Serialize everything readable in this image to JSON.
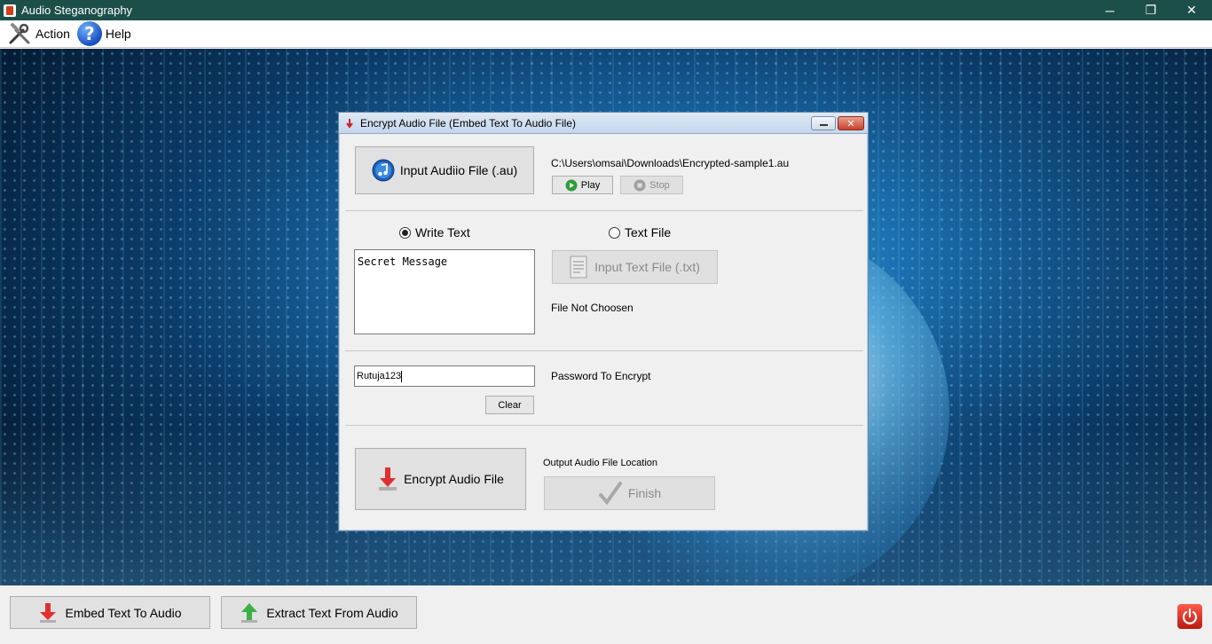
{
  "window": {
    "title": "Audio Steganography",
    "controls": {
      "minimize": "─",
      "maximize": "❐",
      "close": "✕"
    }
  },
  "menu": {
    "action_label": "Action",
    "help_label": "Help"
  },
  "dialog": {
    "title": "Encrypt Audio File (Embed Text To Audio File)",
    "input_audio_button": "Input Audiio File (.au)",
    "audio_path": "C:\\Users\\omsai\\Downloads\\Encrypted-sample1.au",
    "play_button": "Play",
    "stop_button": "Stop",
    "write_text_radio": "Write Text",
    "text_file_radio": "Text File",
    "write_text_selected": true,
    "message_text": "Secret Message",
    "input_text_file_button": "Input Text File (.txt)",
    "text_file_status": "File Not Choosen",
    "password_value": "Rutuja123",
    "password_label": "Password To Encrypt",
    "clear_button": "Clear",
    "encrypt_button": "Encrypt Audio File",
    "output_location_label": "Output Audio File Location",
    "finish_button": "Finish"
  },
  "bottom": {
    "embed_button": "Embed Text To Audio",
    "extract_button": "Extract Text From Audio"
  },
  "colors": {
    "titlebar": "#1c4f4a",
    "embed_arrow": "#e03030",
    "extract_arrow": "#3cb043",
    "power": "#d9261c"
  },
  "icons": {
    "action": "tools-icon",
    "help": "help-icon",
    "audio": "itunes-icon",
    "power": "power-icon"
  }
}
